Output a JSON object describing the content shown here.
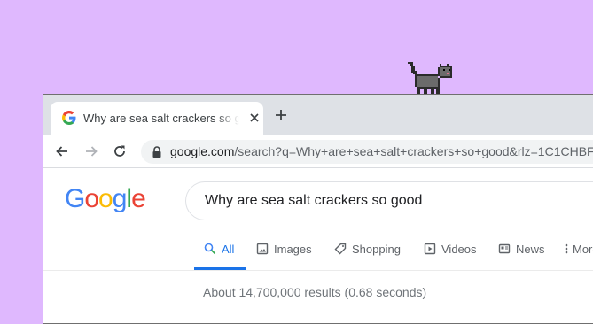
{
  "browser": {
    "tab": {
      "title": "Why are sea salt crackers so good - Google Search",
      "favicon": "google-g-icon",
      "close_icon": "close-icon"
    },
    "new_tab_icon": "plus-icon",
    "toolbar": {
      "back_icon": "arrow-left-icon",
      "forward_icon": "arrow-right-icon",
      "reload_icon": "reload-icon",
      "lock_icon": "lock-icon",
      "url_domain": "google.com",
      "url_path": "/search?q=Why+are+sea+salt+crackers+so+good&rlz=1C1CHBF"
    }
  },
  "google": {
    "logo_letters": [
      "G",
      "o",
      "o",
      "g",
      "l",
      "e"
    ],
    "logo_colors": [
      "#4285f4",
      "#ea4335",
      "#fbbc05",
      "#4285f4",
      "#34a853",
      "#ea4335"
    ],
    "query": "Why are sea salt crackers so good",
    "tabs": [
      {
        "label": "All",
        "icon": "search-icon",
        "active": true
      },
      {
        "label": "Images",
        "icon": "image-icon",
        "active": false
      },
      {
        "label": "Shopping",
        "icon": "tag-icon",
        "active": false
      },
      {
        "label": "Videos",
        "icon": "play-icon",
        "active": false
      },
      {
        "label": "News",
        "icon": "newspaper-icon",
        "active": false
      },
      {
        "label": "More",
        "icon": "dots-vertical-icon",
        "active": false
      }
    ],
    "results_stats": "About 14,700,000 results (0.68 seconds)"
  },
  "colors": {
    "background": "#dfb8fe",
    "accent": "#1a73e8"
  }
}
